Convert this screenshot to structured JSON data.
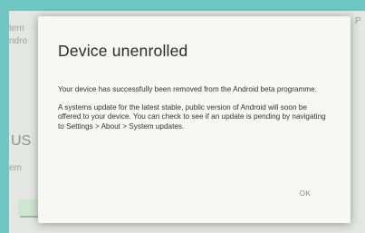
{
  "background": {
    "left_text_lines": [
      "tem",
      "ndro"
    ],
    "left_big_text": "US",
    "left_small_text": "em",
    "right_text": "P"
  },
  "dialog": {
    "title": "Device unenrolled",
    "paragraphs": [
      "Your device has successfully been removed from the Android beta programme.",
      "A systems update for the latest stable, public version of Android will soon be offered to your device. You can check to see if an update is pending by navigating to Settings > About > System updates."
    ],
    "ok_label": "OK"
  },
  "colors": {
    "frame": "#6fc7c3",
    "screen": "#e4e6e3",
    "dialog": "#f7f7f5"
  }
}
